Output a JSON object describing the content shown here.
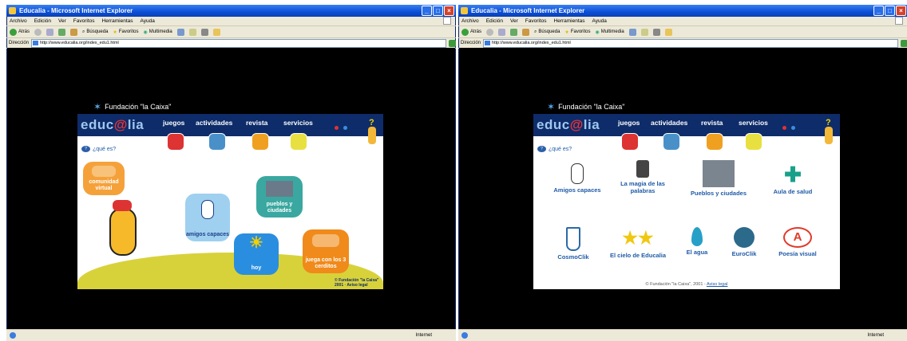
{
  "browser": {
    "title": "Educalia - Microsoft Internet Explorer",
    "menu": [
      "Archivo",
      "Edición",
      "Ver",
      "Favoritos",
      "Herramientas",
      "Ayuda"
    ],
    "toolbar": {
      "back": "Atrás",
      "search": "Búsqueda",
      "favorites": "Favoritos",
      "multimedia": "Multimedia"
    },
    "address_label": "Dirección",
    "zone": "Internet"
  },
  "window1": {
    "url": "http://www.educalia.org/index_edu1.html"
  },
  "window2": {
    "url": "http://www.educalia.org/index_edu1.html"
  },
  "site": {
    "foundation": "Fundación \"la Caixa\"",
    "logo_pre": "educ",
    "logo_at": "@",
    "logo_post": "lia",
    "nav": [
      "juegos",
      "actividades",
      "revista",
      "servicios"
    ],
    "help": "?",
    "que_es": "¿qué es?"
  },
  "page1": {
    "tiles": {
      "comunidad": "comunidad virtual",
      "amigos": "amigos capaces",
      "pueblos": "pueblos y ciudades",
      "hoy": "hoy",
      "juega": "juega con los 3 cerditos"
    },
    "copyright": "© Fundación \"la Caixa\" 2001 · Aviso legal"
  },
  "page2": {
    "activities": [
      "Amigos capaces",
      "La magia de las palabras",
      "Pueblos y ciudades",
      "Aula de salud",
      "CosmoClik",
      "El cielo de Educalia",
      "El agua",
      "EuroClik",
      "Poesía visual"
    ],
    "footer_text": "© Fundación \"la Caixa\", 2001 -",
    "footer_link": "Aviso legal"
  },
  "colors": {
    "navy": "#0e2c6a",
    "xp_blue": "#0a4fd6",
    "accent_yellow": "#d8d23a"
  }
}
